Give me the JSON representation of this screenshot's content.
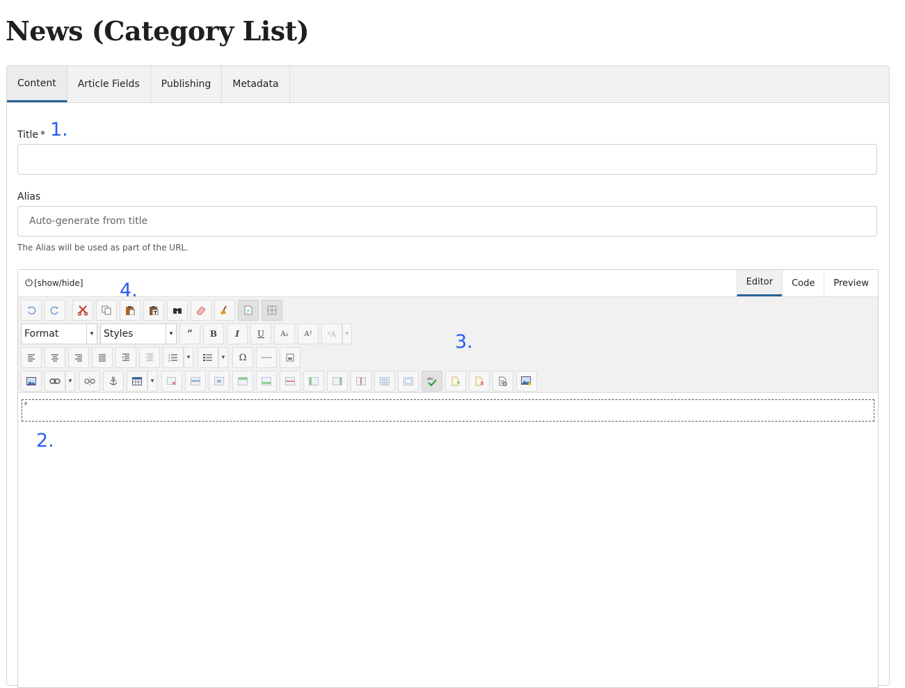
{
  "page": {
    "title": "News (Category List)"
  },
  "tabs": [
    {
      "label": "Content",
      "active": true
    },
    {
      "label": "Article Fields"
    },
    {
      "label": "Publishing"
    },
    {
      "label": "Metadata"
    }
  ],
  "form": {
    "title_label": "Title",
    "title_required": "*",
    "title_value": "",
    "alias_label": "Alias",
    "alias_placeholder": "Auto-generate from title",
    "alias_hint": "The Alias will be used as part of the URL."
  },
  "annotations": [
    "1.",
    "2.",
    "3.",
    "4."
  ],
  "editor": {
    "toggle_label": "[show/hide]",
    "mode_tabs": [
      {
        "label": "Editor",
        "active": true
      },
      {
        "label": "Code"
      },
      {
        "label": "Preview"
      }
    ],
    "format_select": "Format",
    "styles_select": "Styles",
    "block_tag": "P",
    "glyphs": {
      "dropdown": "▾",
      "blockquote": "“",
      "bold": "B",
      "italic": "I",
      "underline": "U",
      "subscript": "A₂",
      "superscript": "A²",
      "font_size": "ᵃA",
      "special_char": "Ω"
    }
  },
  "colors": {
    "accent": "#2a6496",
    "annotation": "#2a5cf0"
  }
}
